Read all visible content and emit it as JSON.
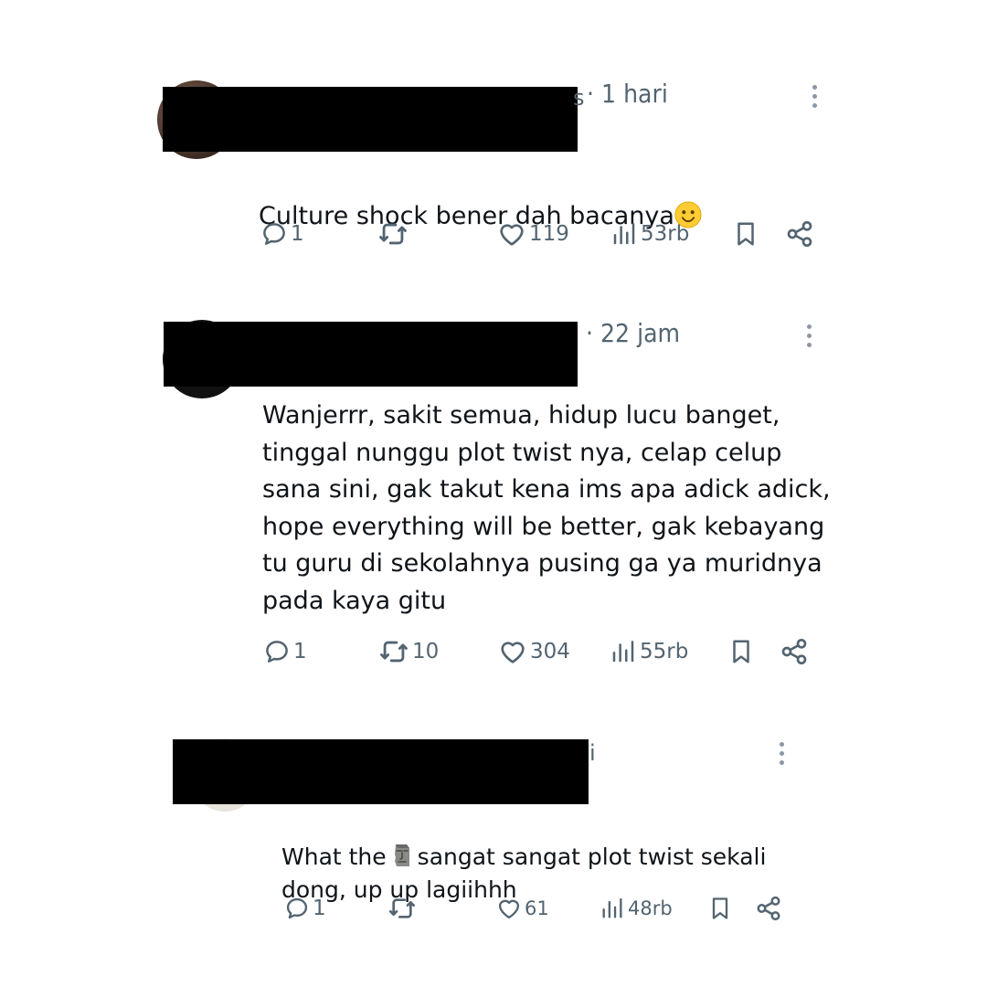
{
  "tweets": [
    {
      "time": "· 1 hari",
      "peek": "s",
      "text": "Culture shock bener dah bacanya",
      "replies": "1",
      "retweets": "",
      "likes": "119",
      "views": "53rb"
    },
    {
      "time": "· 22 jam",
      "peek": "",
      "text": "Wanjerrr, sakit semua, hidup lucu banget,\ntinggal nunggu plot twist nya, celap celup\nsana sini, gak takut kena ims apa adick adick,\nhope everything will be better, gak kebayang\ntu guru di sekolahnya pusing ga ya muridnya\npada kaya gitu",
      "replies": "1",
      "retweets": "10",
      "likes": "304",
      "views": "55rb"
    },
    {
      "time": "",
      "peek": "i",
      "text_before_emoji": "What the",
      "text_after_emoji": "sangat sangat plot twist sekali\ndong, up up lagiihhh",
      "replies": "1",
      "retweets": "",
      "likes": "61",
      "views": "48rb"
    }
  ],
  "icons": {
    "reply": "reply-icon",
    "retweet": "retweet-icon",
    "like": "like-icon",
    "views": "views-icon",
    "bookmark": "bookmark-icon",
    "share": "share-icon",
    "more": "more-icon",
    "emoji_1": "slightly-smiling-face-emoji",
    "emoji_3": "moai-emoji"
  },
  "colors": {
    "text": "#0f1419",
    "secondary": "#536471",
    "redaction": "#000000",
    "background": "#ffffff"
  }
}
